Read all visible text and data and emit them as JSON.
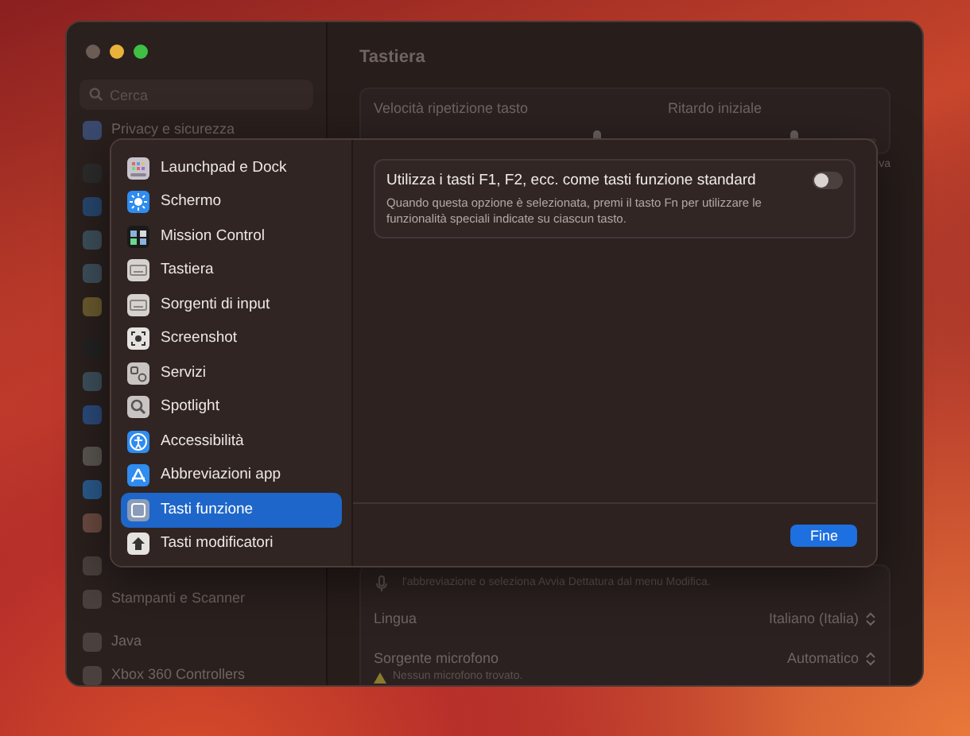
{
  "window": {
    "title": "Tastiera"
  },
  "sidebar": {
    "search": {
      "placeholder": "Cerca"
    },
    "top_item": "Privacy e sicurezza",
    "bottom_items": [
      "Stampanti e Scanner",
      "Java",
      "Xbox 360 Controllers"
    ]
  },
  "main": {
    "sliders": [
      {
        "label": "Velocità ripetizione tasto",
        "level": 0.83
      },
      {
        "label": "Ritardo iniziale",
        "level": 0.6
      }
    ],
    "cut_text": "va",
    "dictation_hint": "l'abbreviazione o seleziona Avvia Dettatura dal menu Modifica.",
    "rows": [
      {
        "label": "Lingua",
        "value": "Italiano (Italia)"
      },
      {
        "label": "Sorgente microfono",
        "value": "Automatico",
        "warning": "Nessun microfono trovato."
      }
    ]
  },
  "sheet": {
    "items": [
      {
        "label": "Launchpad e Dock",
        "selected": false
      },
      {
        "label": "Schermo",
        "selected": false
      },
      {
        "label": "Mission Control",
        "selected": false
      },
      {
        "label": "Tastiera",
        "selected": false
      },
      {
        "label": "Sorgenti di input",
        "selected": false
      },
      {
        "label": "Screenshot",
        "selected": false
      },
      {
        "label": "Servizi",
        "selected": false
      },
      {
        "label": "Spotlight",
        "selected": false
      },
      {
        "label": "Accessibilità",
        "selected": false
      },
      {
        "label": "Abbreviazioni app",
        "selected": false
      },
      {
        "label": "Tasti funzione",
        "selected": true
      },
      {
        "label": "Tasti modificatori",
        "selected": false
      }
    ],
    "option": {
      "title": "Utilizza i tasti F1, F2, ecc. come tasti funzione standard",
      "description": "Quando questa opzione è selezionata, premi il tasto Fn per utilizzare le funzionalità speciali indicate su ciascun tasto.",
      "on": false
    },
    "done_button": "Fine"
  }
}
